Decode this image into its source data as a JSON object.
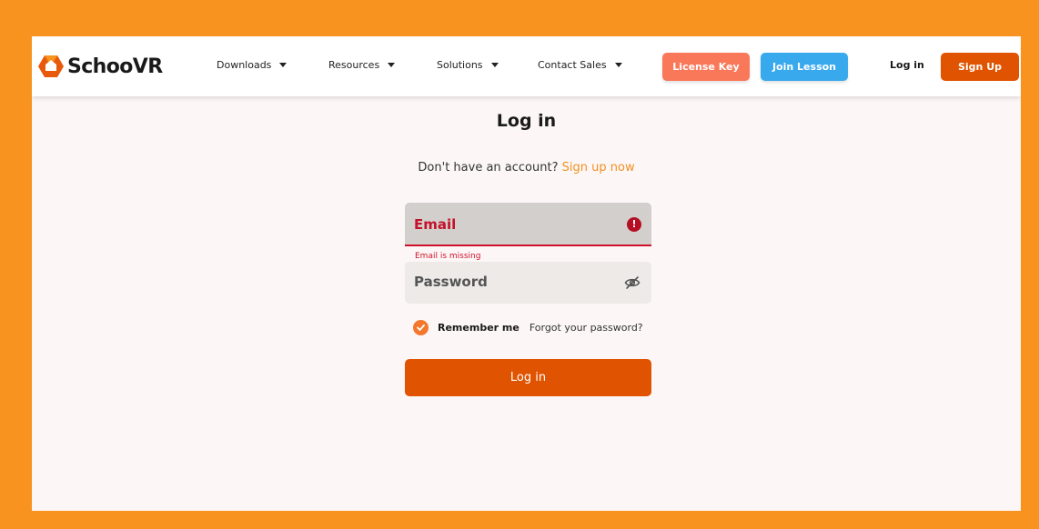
{
  "brand": {
    "name": "SchooVR",
    "logo_icon": "schoovr-logo-icon",
    "accent_color": "#E05300"
  },
  "nav": {
    "items": [
      {
        "label": "Downloads",
        "icon": "chevron-down-icon"
      },
      {
        "label": "Resources",
        "icon": "chevron-down-icon"
      },
      {
        "label": "Solutions",
        "icon": "chevron-down-icon"
      },
      {
        "label": "Contact Sales",
        "icon": "chevron-down-icon"
      }
    ],
    "license_key_label": "License Key",
    "license_key_color": "#F9785A",
    "join_lesson_label": "Join Lesson",
    "join_lesson_color": "#39A9EE",
    "login_label": "Log in",
    "signup_label": "Sign Up"
  },
  "login_form": {
    "title": "Log in",
    "no_account_text": "Don't have an account?",
    "signup_now_label": "Sign up now",
    "email": {
      "label": "Email",
      "value": "",
      "error_message": "Email is missing",
      "error_icon": "error-icon",
      "error_color": "#D0112B"
    },
    "password": {
      "label": "Password",
      "value": "",
      "visibility_icon": "eye-off-icon"
    },
    "remember_me": {
      "label": "Remember me",
      "checked": true
    },
    "forgot_password_label": "Forgot your password?",
    "submit_label": "Log in"
  }
}
